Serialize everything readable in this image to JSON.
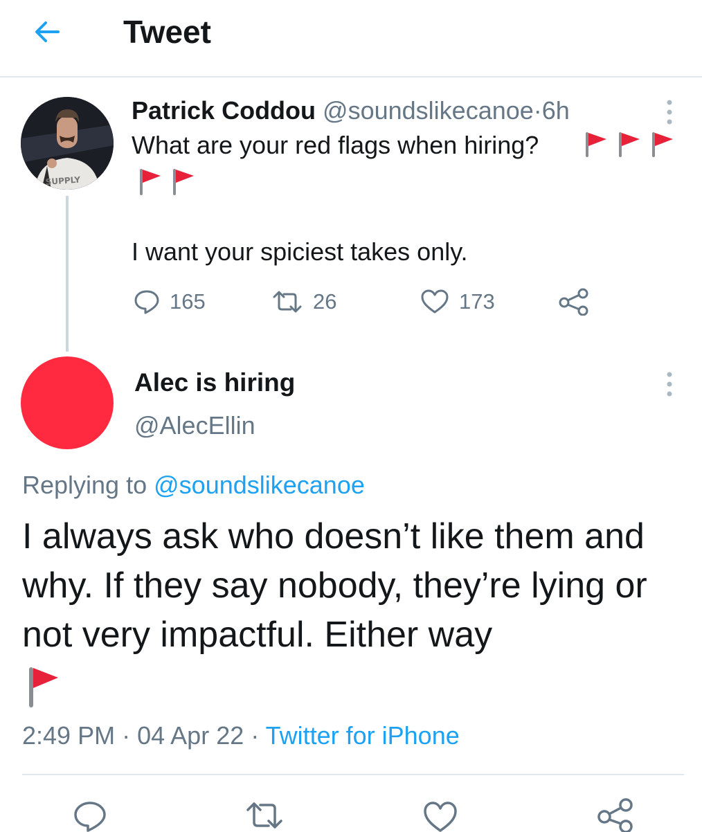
{
  "header": {
    "title": "Tweet"
  },
  "parent_tweet": {
    "author_name": "Patrick Coddou",
    "handle": "@soundslikecanoe",
    "separator": "·",
    "time": "6h",
    "text_line1": "What are your red flags when hiring?",
    "text_line2": "I want your spiciest takes only.",
    "avatar_text": "SUPPLY",
    "flag_count": 5,
    "stats": {
      "replies": "165",
      "retweets": "26",
      "likes": "173"
    }
  },
  "reply_tweet": {
    "author_name": "Alec is hiring",
    "handle": "@AlecEllin",
    "replying_prefix": "Replying to",
    "replying_to": "@soundslikecanoe",
    "body": "I always ask who doesn’t like them and why. If they say nobody, they’re lying or not very impactful. Either way",
    "time": "2:49 PM",
    "date": "04 Apr 22",
    "separator": "·",
    "source": "Twitter for iPhone"
  },
  "icons": {
    "back": "arrow-left-icon",
    "more": "more-vertical-icon",
    "reply": "comment-icon",
    "retweet": "retweet-icon",
    "like": "heart-icon",
    "share": "share-icon",
    "flag": "red-flag-emoji"
  },
  "colors": {
    "accent": "#1da1f2",
    "text_primary": "#14171a",
    "text_secondary": "#657786",
    "divider": "#e1e8ed",
    "avatar_red": "#ff2a40",
    "flag_red": "#e8213a"
  }
}
